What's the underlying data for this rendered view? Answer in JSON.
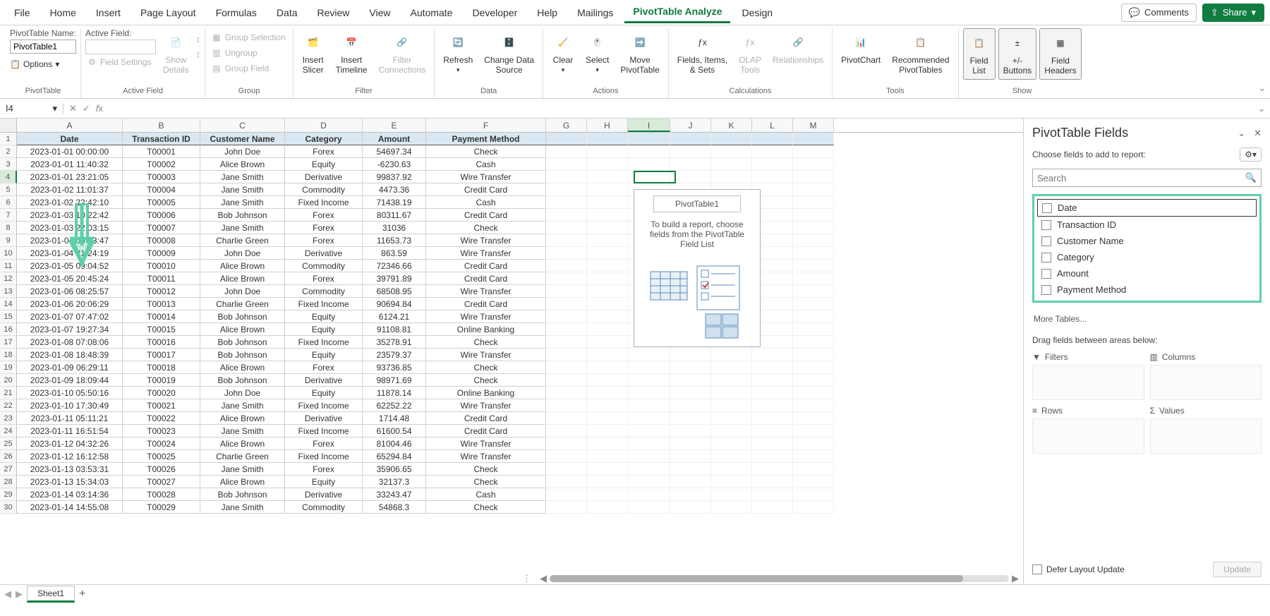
{
  "tabs": [
    "File",
    "Home",
    "Insert",
    "Page Layout",
    "Formulas",
    "Data",
    "Review",
    "View",
    "Automate",
    "Developer",
    "Help",
    "Mailings",
    "PivotTable Analyze",
    "Design"
  ],
  "active_tab": "PivotTable Analyze",
  "comments": "Comments",
  "share": "Share",
  "ribbon": {
    "pivottable_name_label": "PivotTable Name:",
    "pivottable_name_value": "PivotTable1",
    "options": "Options",
    "group_pivottable": "PivotTable",
    "active_field_label": "Active Field:",
    "field_settings": "Field Settings",
    "show_details": "Show\nDetails",
    "group_active_field": "Active Field",
    "group_selection": "Group Selection",
    "ungroup": "Ungroup",
    "group_field": "Group Field",
    "group_group": "Group",
    "insert_slicer": "Insert\nSlicer",
    "insert_timeline": "Insert\nTimeline",
    "filter_connections": "Filter\nConnections",
    "group_filter": "Filter",
    "refresh": "Refresh",
    "change_data_source": "Change Data\nSource",
    "group_data": "Data",
    "clear": "Clear",
    "select": "Select",
    "move_pivottable": "Move\nPivotTable",
    "group_actions": "Actions",
    "fields_items_sets": "Fields, Items,\n& Sets",
    "olap_tools": "OLAP\nTools",
    "relationships": "Relationships",
    "group_calculations": "Calculations",
    "pivotchart": "PivotChart",
    "recommended": "Recommended\nPivotTables",
    "group_tools": "Tools",
    "field_list": "Field\nList",
    "pm_buttons": "+/-\nButtons",
    "field_headers": "Field\nHeaders",
    "group_show": "Show"
  },
  "fx": {
    "name_box": "I4"
  },
  "columns": [
    "A",
    "B",
    "C",
    "D",
    "E",
    "F",
    "G",
    "H",
    "I",
    "J",
    "K",
    "L",
    "M"
  ],
  "table": {
    "headers": [
      "Date",
      "Transaction ID",
      "Customer Name",
      "Category",
      "Amount",
      "Payment Method"
    ],
    "rows": [
      [
        "2023-01-01 00:00:00",
        "T00001",
        "John Doe",
        "Forex",
        "54697.34",
        "Check"
      ],
      [
        "2023-01-01 11:40:32",
        "T00002",
        "Alice Brown",
        "Equity",
        "-6230.63",
        "Cash"
      ],
      [
        "2023-01-01 23:21:05",
        "T00003",
        "Jane Smith",
        "Derivative",
        "99837.92",
        "Wire Transfer"
      ],
      [
        "2023-01-02 11:01:37",
        "T00004",
        "Jane Smith",
        "Commodity",
        "4473.36",
        "Credit Card"
      ],
      [
        "2023-01-02 22:42:10",
        "T00005",
        "Jane Smith",
        "Fixed Income",
        "71438.19",
        "Cash"
      ],
      [
        "2023-01-03 10:22:42",
        "T00006",
        "Bob Johnson",
        "Forex",
        "80311.67",
        "Credit Card"
      ],
      [
        "2023-01-03 22:03:15",
        "T00007",
        "Jane Smith",
        "Forex",
        "31036",
        "Check"
      ],
      [
        "2023-01-04 09:43:47",
        "T00008",
        "Charlie Green",
        "Forex",
        "11653.73",
        "Wire Transfer"
      ],
      [
        "2023-01-04 21:24:19",
        "T00009",
        "John Doe",
        "Derivative",
        "863.59",
        "Wire Transfer"
      ],
      [
        "2023-01-05 09:04:52",
        "T00010",
        "Alice Brown",
        "Commodity",
        "72346.66",
        "Credit Card"
      ],
      [
        "2023-01-05 20:45:24",
        "T00011",
        "Alice Brown",
        "Forex",
        "39791.89",
        "Credit Card"
      ],
      [
        "2023-01-06 08:25:57",
        "T00012",
        "John Doe",
        "Commodity",
        "68508.95",
        "Wire Transfer"
      ],
      [
        "2023-01-06 20:06:29",
        "T00013",
        "Charlie Green",
        "Fixed Income",
        "90694.84",
        "Credit Card"
      ],
      [
        "2023-01-07 07:47:02",
        "T00014",
        "Bob Johnson",
        "Equity",
        "6124.21",
        "Wire Transfer"
      ],
      [
        "2023-01-07 19:27:34",
        "T00015",
        "Alice Brown",
        "Equity",
        "91108.81",
        "Online Banking"
      ],
      [
        "2023-01-08 07:08:06",
        "T00016",
        "Bob Johnson",
        "Fixed Income",
        "35278.91",
        "Check"
      ],
      [
        "2023-01-08 18:48:39",
        "T00017",
        "Bob Johnson",
        "Equity",
        "23579.37",
        "Wire Transfer"
      ],
      [
        "2023-01-09 06:29:11",
        "T00018",
        "Alice Brown",
        "Forex",
        "93736.85",
        "Check"
      ],
      [
        "2023-01-09 18:09:44",
        "T00019",
        "Bob Johnson",
        "Derivative",
        "98971.69",
        "Check"
      ],
      [
        "2023-01-10 05:50:16",
        "T00020",
        "John Doe",
        "Equity",
        "11878.14",
        "Online Banking"
      ],
      [
        "2023-01-10 17:30:49",
        "T00021",
        "Jane Smith",
        "Fixed Income",
        "62252.22",
        "Wire Transfer"
      ],
      [
        "2023-01-11 05:11:21",
        "T00022",
        "Alice Brown",
        "Derivative",
        "1714.48",
        "Credit Card"
      ],
      [
        "2023-01-11 16:51:54",
        "T00023",
        "Jane Smith",
        "Fixed Income",
        "61600.54",
        "Credit Card"
      ],
      [
        "2023-01-12 04:32:26",
        "T00024",
        "Alice Brown",
        "Forex",
        "81004.46",
        "Wire Transfer"
      ],
      [
        "2023-01-12 16:12:58",
        "T00025",
        "Charlie Green",
        "Fixed Income",
        "65294.84",
        "Wire Transfer"
      ],
      [
        "2023-01-13 03:53:31",
        "T00026",
        "Jane Smith",
        "Forex",
        "35906.65",
        "Check"
      ],
      [
        "2023-01-13 15:34:03",
        "T00027",
        "Alice Brown",
        "Equity",
        "32137.3",
        "Check"
      ],
      [
        "2023-01-14 03:14:36",
        "T00028",
        "Bob Johnson",
        "Derivative",
        "33243.47",
        "Cash"
      ],
      [
        "2023-01-14 14:55:08",
        "T00029",
        "Jane Smith",
        "Commodity",
        "54868.3",
        "Check"
      ]
    ]
  },
  "pivot_placeholder": {
    "title": "PivotTable1",
    "line1": "To build a report, choose",
    "line2": "fields from the PivotTable",
    "line3": "Field List"
  },
  "sheet_tabs": {
    "active": "Sheet1"
  },
  "pane": {
    "title": "PivotTable Fields",
    "subtitle": "Choose fields to add to report:",
    "search_placeholder": "Search",
    "fields": [
      "Date",
      "Transaction ID",
      "Customer Name",
      "Category",
      "Amount",
      "Payment Method"
    ],
    "more_tables": "More Tables...",
    "drag_label": "Drag fields between areas below:",
    "filters": "Filters",
    "columns": "Columns",
    "rows": "Rows",
    "values": "Values",
    "defer": "Defer Layout Update",
    "update": "Update"
  }
}
